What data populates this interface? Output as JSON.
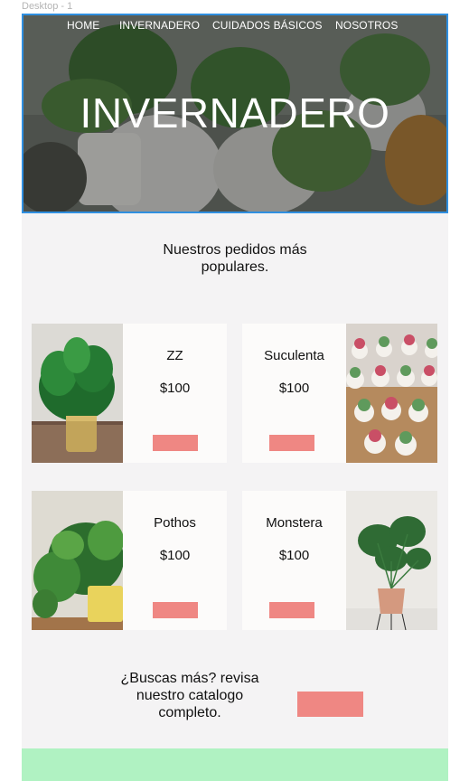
{
  "frame": {
    "label": "Desktop - 1"
  },
  "nav": {
    "items": [
      "HOME",
      "INVERNADERO",
      "CUIDADOS BÁSICOS",
      "NOSOTROS"
    ]
  },
  "hero": {
    "title": "INVERNADERO"
  },
  "popular": {
    "title": "Nuestros pedidos más populares.",
    "products": [
      {
        "name": "ZZ",
        "price": "$100",
        "image": "zz-plant-photo"
      },
      {
        "name": "Suculenta",
        "price": "$100",
        "image": "succulents-photo"
      },
      {
        "name": "Pothos",
        "price": "$100",
        "image": "pothos-photo"
      },
      {
        "name": "Monstera",
        "price": "$100",
        "image": "monstera-photo"
      }
    ]
  },
  "catalog": {
    "text": "¿Buscas más? revisa nuestro catalogo completo."
  },
  "colors": {
    "accent_button": "#ef8783",
    "footer": "#b0f2c2",
    "background": "#f4f3f4",
    "card": "#fcfbfa",
    "selection_border": "#2f8fe0"
  }
}
